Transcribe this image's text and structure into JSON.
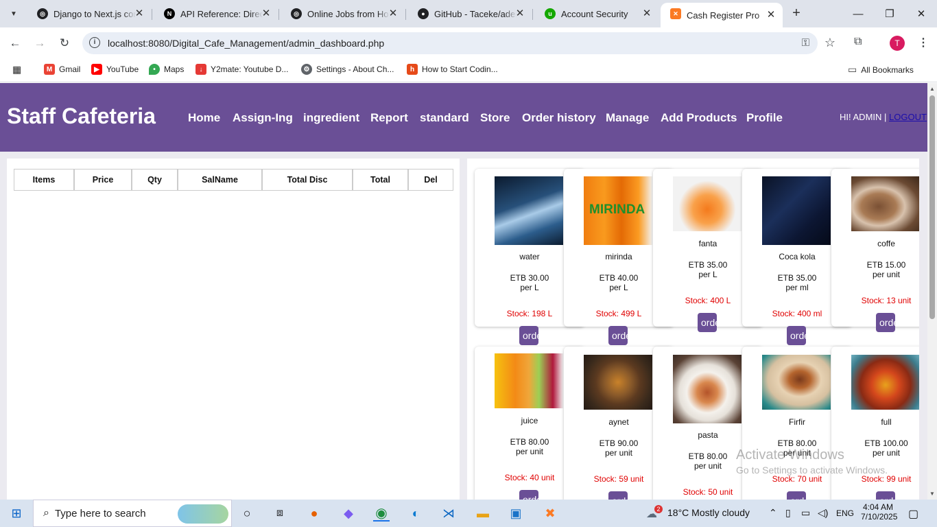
{
  "browser": {
    "tabs": [
      {
        "title": "Django to Next.js cor",
        "icon": "openai-icon",
        "color": "#202124"
      },
      {
        "title": "API Reference: Directi",
        "icon": "nextjs-icon",
        "color": "#000000"
      },
      {
        "title": "Online Jobs from Hor",
        "icon": "openai-icon",
        "color": "#202124"
      },
      {
        "title": "GitHub - Taceke/aden",
        "icon": "github-icon",
        "color": "#202124"
      },
      {
        "title": "Account Security",
        "icon": "upwork-icon",
        "color": "#14a800"
      },
      {
        "title": "Cash Register Pro",
        "icon": "xampp-icon",
        "color": "#fb7a24"
      }
    ],
    "url": "localhost:8080/Digital_Cafe_Management/admin_dashboard.php",
    "profile_initial": "T",
    "bookmarks": [
      {
        "label": "Gmail",
        "icon": "gmail-icon",
        "color": "#ea4335"
      },
      {
        "label": "YouTube",
        "icon": "youtube-icon",
        "color": "#ff0000"
      },
      {
        "label": "Maps",
        "icon": "maps-icon",
        "color": "#34a853"
      },
      {
        "label": "Y2mate: Youtube D...",
        "icon": "y2mate-icon",
        "color": "#e53935"
      },
      {
        "label": "Settings - About Ch...",
        "icon": "gear-icon",
        "color": "#5f6368"
      },
      {
        "label": "How to Start Codin...",
        "icon": "hackernoon-icon",
        "color": "#e64a19"
      }
    ],
    "all_bookmarks": "All Bookmarks"
  },
  "site": {
    "brand": "Staff Cafeteria",
    "nav": [
      "Home",
      "Assign-Ing",
      "ingredient",
      "Report",
      "standard",
      "Store",
      "Order history",
      "Manage",
      "Add Products",
      "Profile"
    ],
    "greeting": "HI! ADMIN | ",
    "logout": "LOGOUT",
    "accent": "#6a4f96"
  },
  "cart": {
    "columns": [
      "Items",
      "Price",
      "Qty",
      "SalName",
      "Total Disc",
      "Total",
      "Del"
    ]
  },
  "products": [
    {
      "name": "water",
      "price": "ETB 30.00",
      "unit": "per L",
      "stock": "Stock: 198 L",
      "btn": "order"
    },
    {
      "name": "mirinda",
      "price": "ETB 40.00",
      "unit": "per L",
      "stock": "Stock: 499 L",
      "btn": "order"
    },
    {
      "name": "fanta",
      "price": "ETB 35.00",
      "unit": "per L",
      "stock": "Stock: 400 L",
      "btn": "order"
    },
    {
      "name": "Coca kola",
      "price": "ETB 35.00",
      "unit": "per ml",
      "stock": "Stock: 400 ml",
      "btn": "order"
    },
    {
      "name": "coffe",
      "price": "ETB 15.00",
      "unit": "per unit",
      "stock": "Stock: 13 unit",
      "btn": "order"
    },
    {
      "name": "juice",
      "price": "ETB 80.00",
      "unit": "per unit",
      "stock": "Stock: 40 unit",
      "btn": "order"
    },
    {
      "name": "aynet",
      "price": "ETB 90.00",
      "unit": "per unit",
      "stock": "Stock: 59 unit",
      "btn": "order"
    },
    {
      "name": "pasta",
      "price": "ETB 80.00",
      "unit": "per unit",
      "stock": "Stock: 50 unit",
      "btn": "order"
    },
    {
      "name": "Firfir",
      "price": "ETB 80.00",
      "unit": "per unit",
      "stock": "Stock: 70 unit",
      "btn": "order"
    },
    {
      "name": "full",
      "price": "ETB 100.00",
      "unit": "per unit",
      "stock": "Stock: 99 unit",
      "btn": "order"
    }
  ],
  "watermark": {
    "line1": "Activate Windows",
    "line2": "Go to Settings to activate Windows."
  },
  "taskbar": {
    "search_placeholder": "Type here to search",
    "weather": "18°C  Mostly cloudy",
    "weather_badge": "2",
    "language": "ENG",
    "time": "4:04 AM",
    "date": "7/10/2025"
  }
}
